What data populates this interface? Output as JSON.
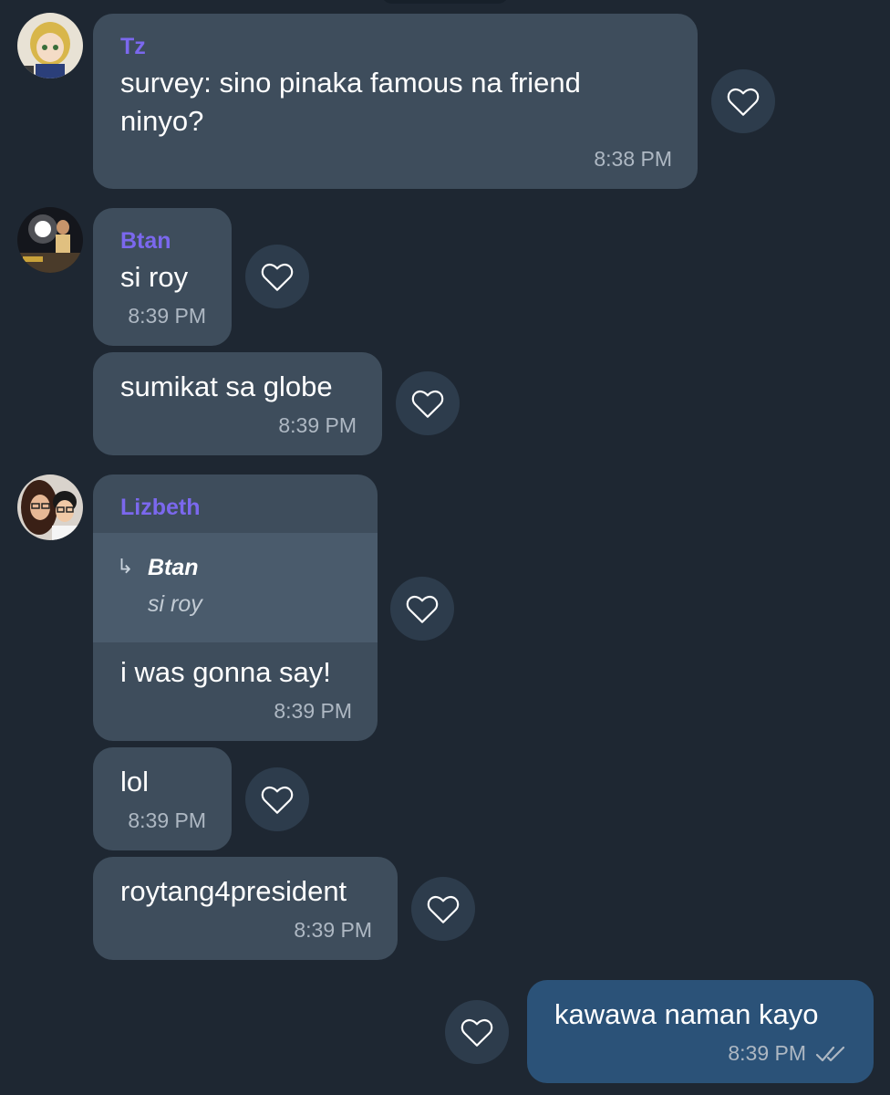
{
  "colors": {
    "background": "#1e2732",
    "bubble_in": "#3e4d5c",
    "bubble_out": "#2b5278",
    "sender_name": "#7b68ee",
    "timestamp": "#aeb8c3",
    "like_button": "#2d3c4c"
  },
  "messages": [
    {
      "sender": "Tz",
      "text_line1": "survey: sino pinaka famous na friend",
      "text_line2": "ninyo?",
      "time": "8:38 PM"
    },
    {
      "sender": "Btan",
      "text": "si roy",
      "time": "8:39 PM"
    },
    {
      "text": "sumikat sa globe",
      "time": "8:39 PM"
    },
    {
      "sender": "Lizbeth",
      "reply_to": {
        "sender": "Btan",
        "text": "si roy"
      },
      "text": "i was gonna say!",
      "time": "8:39 PM"
    },
    {
      "text": "lol",
      "time": "8:39 PM"
    },
    {
      "text": "roytang4president",
      "time": "8:39 PM"
    },
    {
      "outgoing": true,
      "text": "kawawa naman kayo",
      "time": "8:39 PM",
      "status_icon": "double-check-icon"
    }
  ],
  "icons": {
    "like": "heart-outline-icon",
    "reply": "reply-arrow-icon"
  }
}
